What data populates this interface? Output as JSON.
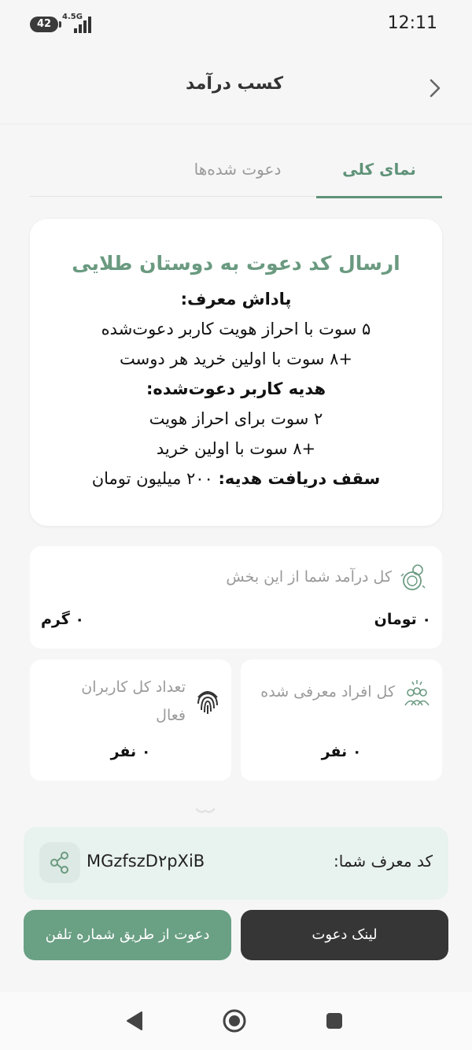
{
  "status_bar": {
    "battery": "42",
    "network": "4.5G",
    "time": "12:11"
  },
  "header": {
    "title": "کسب درآمد",
    "back_icon": "chevron-right-icon"
  },
  "tabs": [
    {
      "label": "نمای کلی",
      "active": true
    },
    {
      "label": "دعوت شده‌ها",
      "active": false
    }
  ],
  "info_card": {
    "title": "ارسال کد دعوت به دوستان طلایی",
    "lines": [
      {
        "text": "پاداش معرف:",
        "bold": true
      },
      {
        "text": "۵ سوت با احراز هویت کاربر دعوت‌شده",
        "bold": false
      },
      {
        "text": "+۸ سوت با اولین خرید هر دوست",
        "bold": false
      },
      {
        "text": "هدیه کاربر دعوت‌شده:",
        "bold": true
      },
      {
        "text": "۲ سوت برای احراز هویت",
        "bold": false
      },
      {
        "text": "+۸ سوت با اولین خرید",
        "bold": false
      }
    ],
    "cap_label": "سقف دریافت هدیه:",
    "cap_value": " ۲۰۰ میلیون تومان"
  },
  "stats": {
    "income": {
      "label": "کل درآمد شما از این بخش",
      "value_toman": "۰ تومان",
      "value_gram": "۰ گرم",
      "icon": "coin-stack-icon"
    },
    "referred": {
      "label": "کل افراد معرفی شده",
      "value": "۰ نفر",
      "icon": "people-group-icon"
    },
    "active_users": {
      "label_line1": "تعداد کل کاربران",
      "label_line2": "فعال",
      "value": "۰ نفر",
      "icon": "fingerprint-icon"
    }
  },
  "referral": {
    "label": "کد معرف شما:",
    "code": "MGzfszD۲pXiB",
    "share_icon": "share-icon"
  },
  "buttons": {
    "invite_link": "لینک دعوت",
    "invite_phone": "دعوت از طریق شماره تلفن"
  },
  "colors": {
    "accent": "#5f9278",
    "primary_button": "#363636",
    "secondary_button": "#6aa084",
    "referral_bg": "#e8f2ee"
  }
}
